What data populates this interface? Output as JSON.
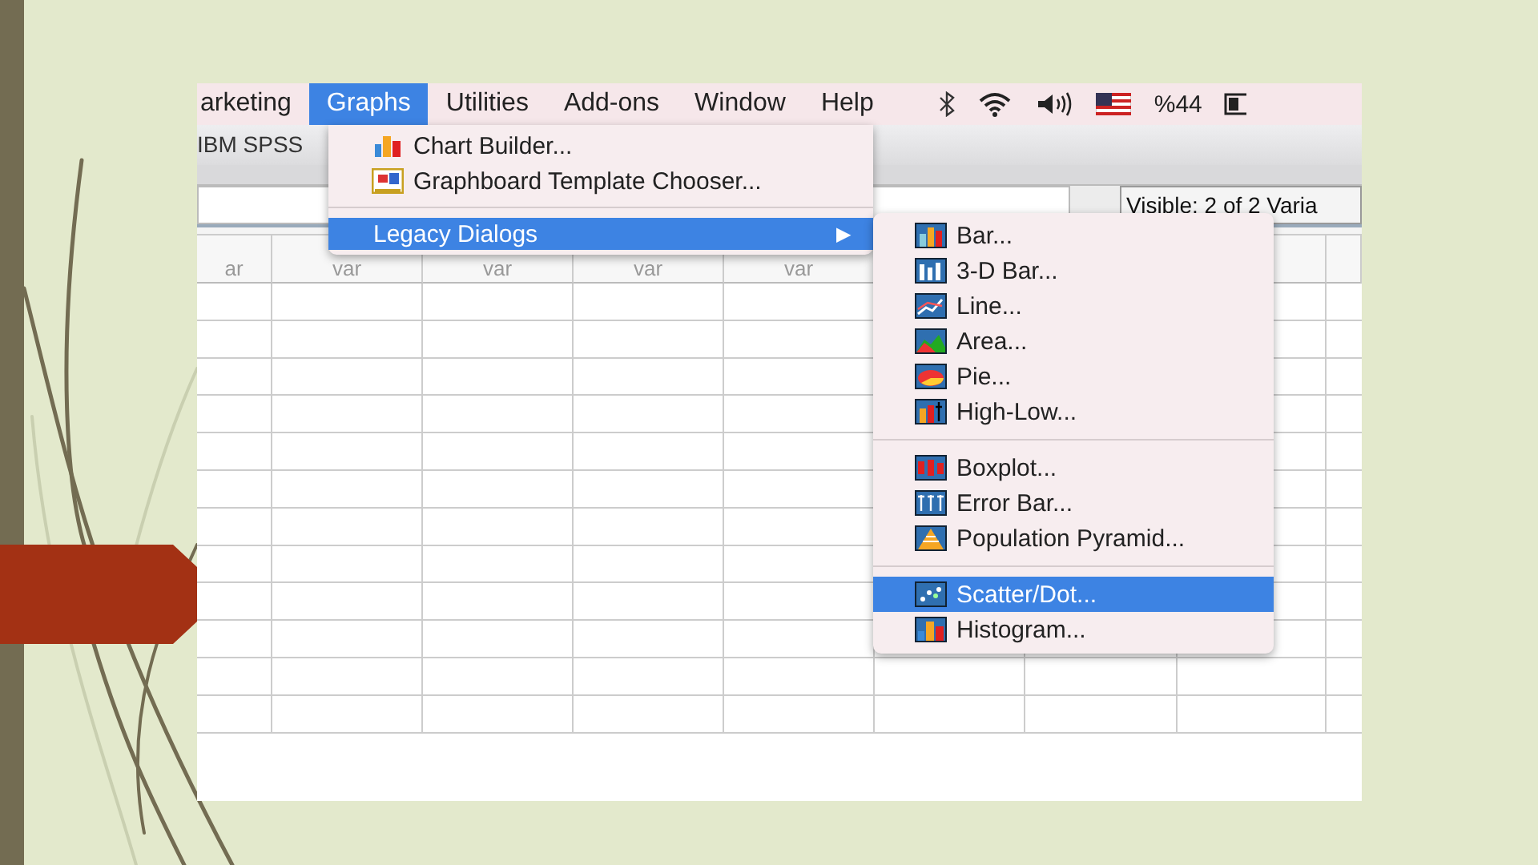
{
  "menu_bar": {
    "items": [
      {
        "label": "arketing",
        "selected": false
      },
      {
        "label": "Graphs",
        "selected": true
      },
      {
        "label": "Utilities",
        "selected": false
      },
      {
        "label": "Add-ons",
        "selected": false
      },
      {
        "label": "Window",
        "selected": false
      },
      {
        "label": "Help",
        "selected": false
      }
    ],
    "battery_text": "%44"
  },
  "toolbar": {
    "title": "IBM SPSS"
  },
  "visible_label": "Visible: 2 of 2 Varia",
  "columns": [
    "ar",
    "var",
    "var",
    "var",
    "var"
  ],
  "graphs_menu": [
    {
      "kind": "item",
      "label": "Chart Builder...",
      "selected": false
    },
    {
      "kind": "item",
      "label": "Graphboard Template Chooser...",
      "selected": false
    },
    {
      "kind": "separator"
    },
    {
      "kind": "submenu",
      "label": "Legacy Dialogs",
      "arrow": "▶",
      "selected": true
    }
  ],
  "legacy_menu": [
    {
      "kind": "item",
      "label": "Bar...",
      "selected": false
    },
    {
      "kind": "item",
      "label": "3-D Bar...",
      "selected": false
    },
    {
      "kind": "item",
      "label": "Line...",
      "selected": false
    },
    {
      "kind": "item",
      "label": "Area...",
      "selected": false
    },
    {
      "kind": "item",
      "label": "Pie...",
      "selected": false
    },
    {
      "kind": "item",
      "label": "High-Low...",
      "selected": false
    },
    {
      "kind": "separator"
    },
    {
      "kind": "item",
      "label": "Boxplot...",
      "selected": false
    },
    {
      "kind": "item",
      "label": "Error Bar...",
      "selected": false
    },
    {
      "kind": "item",
      "label": "Population Pyramid...",
      "selected": false
    },
    {
      "kind": "separator"
    },
    {
      "kind": "item",
      "label": "Scatter/Dot...",
      "selected": true
    },
    {
      "kind": "item",
      "label": "Histogram...",
      "selected": false
    }
  ]
}
